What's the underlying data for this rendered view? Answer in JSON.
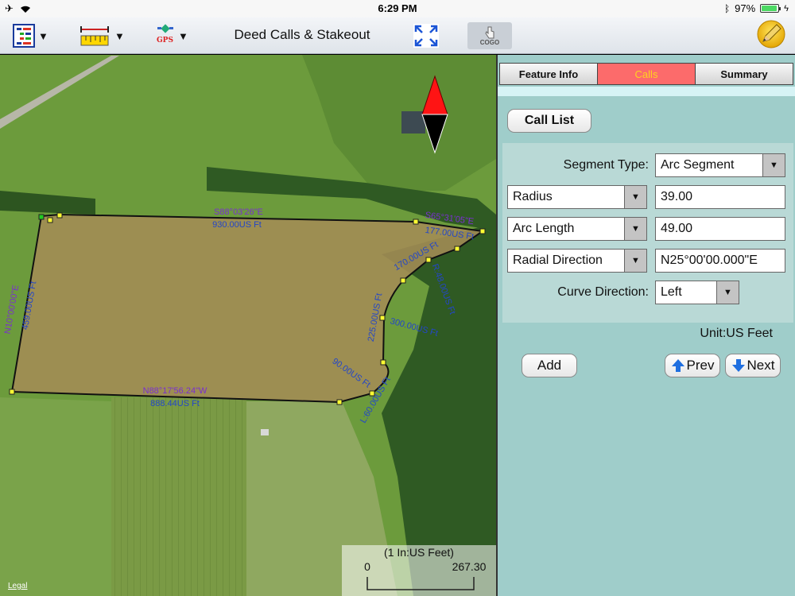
{
  "status": {
    "time": "6:29 PM",
    "battery": "97%",
    "battery_level": 0.97
  },
  "toolbar": {
    "title": "Deed Calls & Stakeout",
    "layers_icon": "layers-list-icon",
    "measure_icon": "ruler-icon",
    "gps_icon": "gps-icon",
    "gps_text": "GPS",
    "fullscreen_icon": "expand-arrows-icon",
    "cogo_text": "COGO",
    "cogo_icon": "hand-pointer-icon",
    "edit_icon": "pencil-icon"
  },
  "map": {
    "labels": {
      "top_bearing": "S88°03'26\"E",
      "top_dist": "930.00US Ft",
      "left_bearing": "N10°00'00\"E",
      "left_dist": "459.00US Ft",
      "bottom_bearing": "N88°17'56.24\"W",
      "bottom_dist": "888.44US Ft",
      "ne_bearing": "S65°31'05\"E",
      "ne_dist": "177.00US Ft",
      "d170": "170.00US Ft",
      "d225": "225.00US Ft",
      "d90": "90.00US Ft",
      "arc1": "R:48.00US Ft",
      "arc2": "300.00US Ft",
      "arc3": "L:60.00US Ft"
    },
    "scale": {
      "title": "(1 In:US Feet)",
      "min": "0",
      "max": "267.30"
    },
    "legal": "Legal",
    "north_arrow_icon": "north-arrow-icon"
  },
  "panel": {
    "tabs": [
      {
        "label": "Feature Info",
        "active": false
      },
      {
        "label": "Calls",
        "active": true
      },
      {
        "label": "Summary",
        "active": false
      }
    ],
    "call_list": "Call List",
    "segment_type_label": "Segment Type:",
    "segment_type_value": "Arc Segment",
    "row1_select": "Radius",
    "row1_value": "39.00",
    "row2_select": "Arc Length",
    "row2_value": "49.00",
    "row3_select": "Radial Direction",
    "row3_value": "N25°00'00.000\"E",
    "curve_label": "Curve Direction:",
    "curve_value": "Left",
    "unit": "Unit:US Feet",
    "add": "Add",
    "prev": "Prev",
    "next": "Next"
  },
  "colors": {
    "panel_bg": "#9fcdca",
    "tab_active": "#fc6b6b",
    "label_blue": "#2346c8",
    "label_purple": "#7a2fd0",
    "parcel_fill": "#a48c55"
  }
}
